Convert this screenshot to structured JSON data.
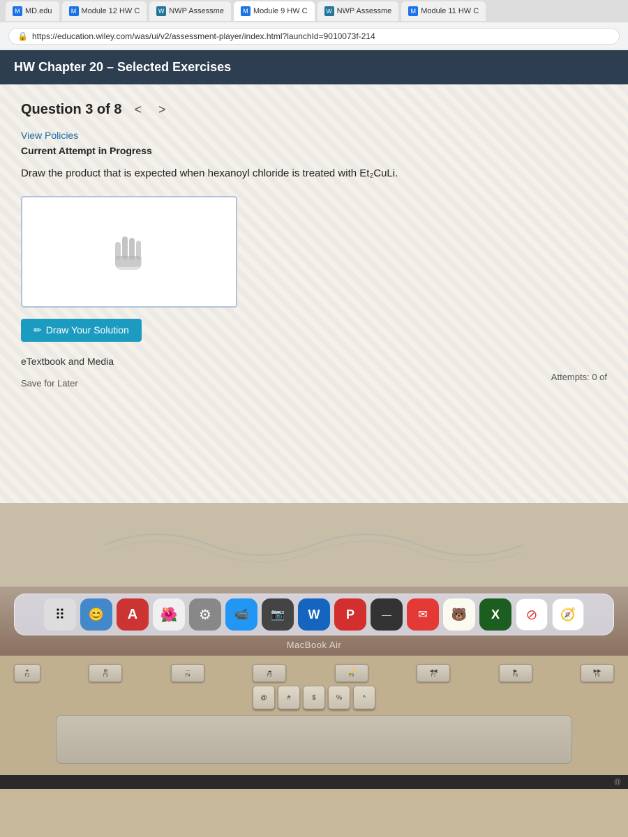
{
  "browser": {
    "tabs": [
      {
        "id": "tab1",
        "favicon_type": "normal",
        "label": "MD.edu",
        "active": false
      },
      {
        "id": "tab2",
        "favicon_type": "normal",
        "label": "Module 12 HW C",
        "active": false
      },
      {
        "id": "tab3",
        "favicon_type": "wp",
        "label": "NWP Assessme",
        "active": false
      },
      {
        "id": "tab4",
        "favicon_type": "normal",
        "label": "Module 9 HW C",
        "active": true
      },
      {
        "id": "tab5",
        "favicon_type": "wp",
        "label": "NWP Assessme",
        "active": false
      },
      {
        "id": "tab6",
        "favicon_type": "normal",
        "label": "Module 11 HW C",
        "active": false
      }
    ],
    "address": "https://education.wiley.com/was/ui/v2/assessment-player/index.html?launchId=9010073f-214"
  },
  "page": {
    "header": "HW Chapter 20 – Selected Exercises",
    "question_nav": "Question 3 of 8",
    "nav_prev": "<",
    "nav_next": ">",
    "view_policies": "View Policies",
    "current_attempt": "Current Attempt in Progress",
    "question_text": "Draw the product that is expected when hexanoyl chloride is treated with Et₂CuLi.",
    "draw_button": "Draw Your Solution",
    "etextbook": "eTextbook and Media",
    "save_later": "Save for Later",
    "attempts": "Attempts: 0 of"
  },
  "dock": {
    "icons": [
      {
        "id": "launchpad",
        "emoji": "⠿",
        "bg": "#f5f5f5"
      },
      {
        "id": "finder",
        "emoji": "😊",
        "bg": "#2196f3"
      },
      {
        "id": "a-icon",
        "emoji": "A",
        "bg": "#f44336"
      },
      {
        "id": "photos",
        "emoji": "🌺",
        "bg": "#ff9800"
      },
      {
        "id": "settings",
        "emoji": "⚙",
        "bg": "#9e9e9e"
      },
      {
        "id": "zoom",
        "emoji": "📹",
        "bg": "#2196f3"
      },
      {
        "id": "video",
        "emoji": "📷",
        "bg": "#555"
      },
      {
        "id": "word",
        "emoji": "W",
        "bg": "#1565c0"
      },
      {
        "id": "powerpoint",
        "emoji": "P",
        "bg": "#d32f2f"
      },
      {
        "id": "teams",
        "emoji": "—",
        "bg": "#444"
      },
      {
        "id": "mail",
        "emoji": "✉",
        "bg": "#e53935"
      },
      {
        "id": "bear",
        "emoji": "🐻",
        "bg": "#f5f5dc"
      },
      {
        "id": "excel",
        "emoji": "X",
        "bg": "#1b5e20"
      },
      {
        "id": "compass",
        "emoji": "⊘",
        "bg": "#fff"
      },
      {
        "id": "safari",
        "emoji": "🧭",
        "bg": "#fff"
      }
    ],
    "macbook_label": "MacBook Air"
  },
  "keyboard": {
    "fn_row": [
      {
        "label": "F2",
        "sub": "☀"
      },
      {
        "label": "F3",
        "sub": "⊞"
      },
      {
        "label": "F4",
        "sub": "⋯"
      },
      {
        "label": "F5",
        "sub": "☁"
      },
      {
        "label": "F6",
        "sub": "🌙"
      },
      {
        "label": "F7",
        "sub": "◀◀"
      },
      {
        "label": "F8",
        "sub": "▶"
      },
      {
        "label": "F9",
        "sub": "▶▶"
      }
    ],
    "row2": [
      "@",
      "#",
      "$",
      "%",
      "^"
    ]
  }
}
